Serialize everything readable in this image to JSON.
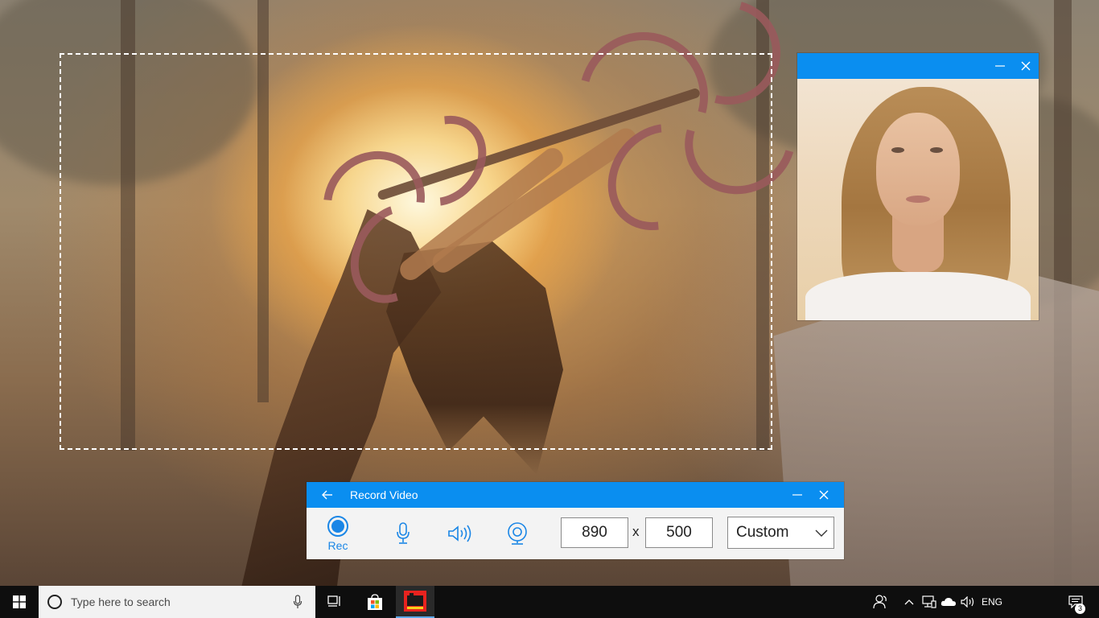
{
  "cam_window": {
    "minimize_icon": "minimize-icon",
    "close_icon": "close-icon"
  },
  "recorder": {
    "title": "Record Video",
    "back_icon": "back-arrow-icon",
    "rec_label": "Rec",
    "microphone_icon": "microphone-icon",
    "speaker_icon": "speaker-icon",
    "webcam_icon": "webcam-icon",
    "width_value": "890",
    "separator": "x",
    "height_value": "500",
    "preset_value": "Custom",
    "accent_color": "#0a8ef0"
  },
  "taskbar": {
    "search_placeholder": "Type here to search",
    "language": "ENG",
    "notification_count": "3"
  }
}
